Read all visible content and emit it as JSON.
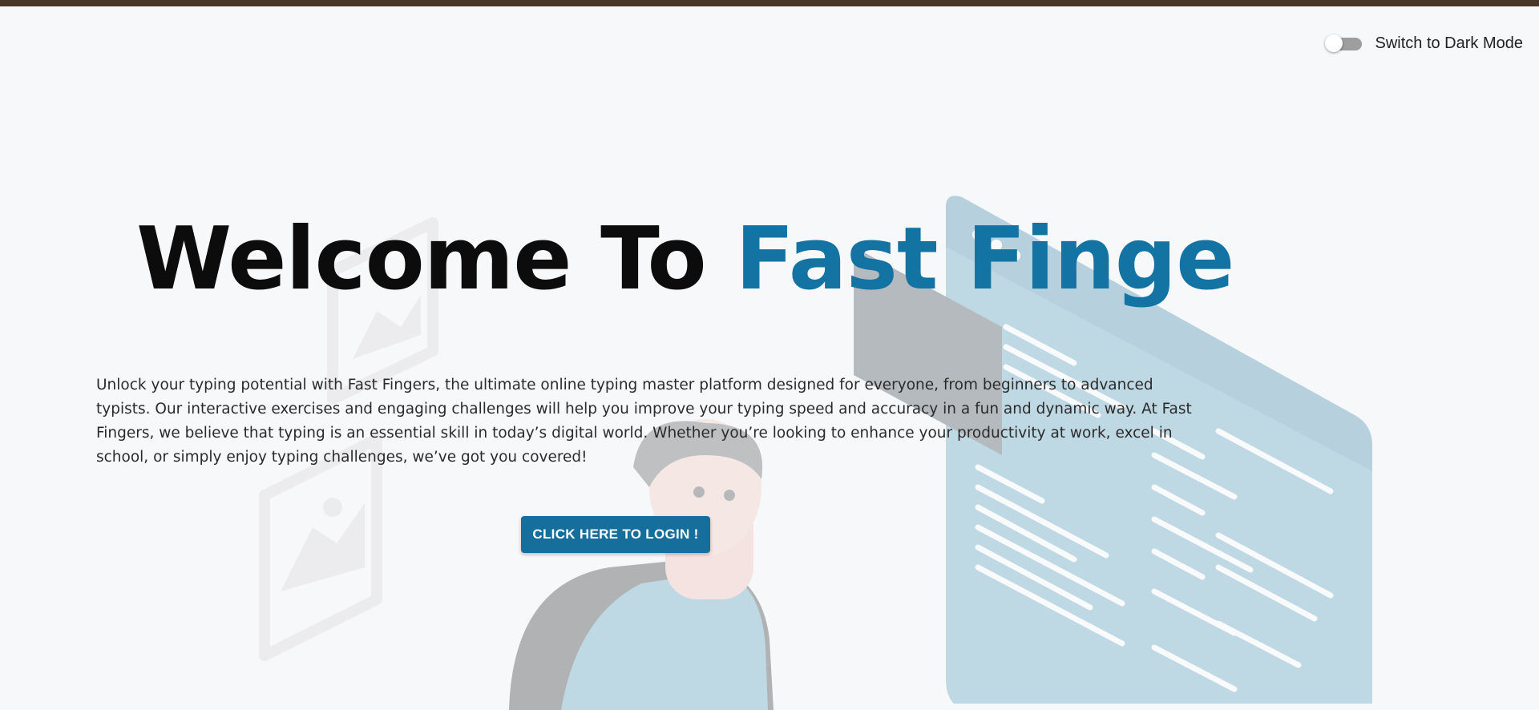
{
  "header": {
    "dark_mode_label": "Switch to Dark Mode",
    "dark_mode_enabled": false
  },
  "hero": {
    "title_prefix": "Welcome To ",
    "title_highlight": "Fast Finge",
    "description": "Unlock your typing potential with Fast Fingers, the ultimate online typing master platform designed for everyone, from beginners to advanced typists. Our interactive exercises and engaging challenges will help you improve your typing speed and accuracy in a fun and dynamic way. At Fast Fingers, we believe that typing is an essential skill in today’s digital world. Whether you’re looking to enhance your productivity at work, excel in school, or simply enjoy typing challenges, we’ve got you covered!",
    "login_button_label": "CLICK HERE TO LOGIN !"
  },
  "colors": {
    "top_bar": "#4a3826",
    "background": "#f7f8fa",
    "brand_accent": "#1373a3",
    "button": "#166e9c",
    "toggle_track": "#9e9e9e"
  },
  "icons": {
    "background_illustration": "person-at-computer-illustration"
  }
}
